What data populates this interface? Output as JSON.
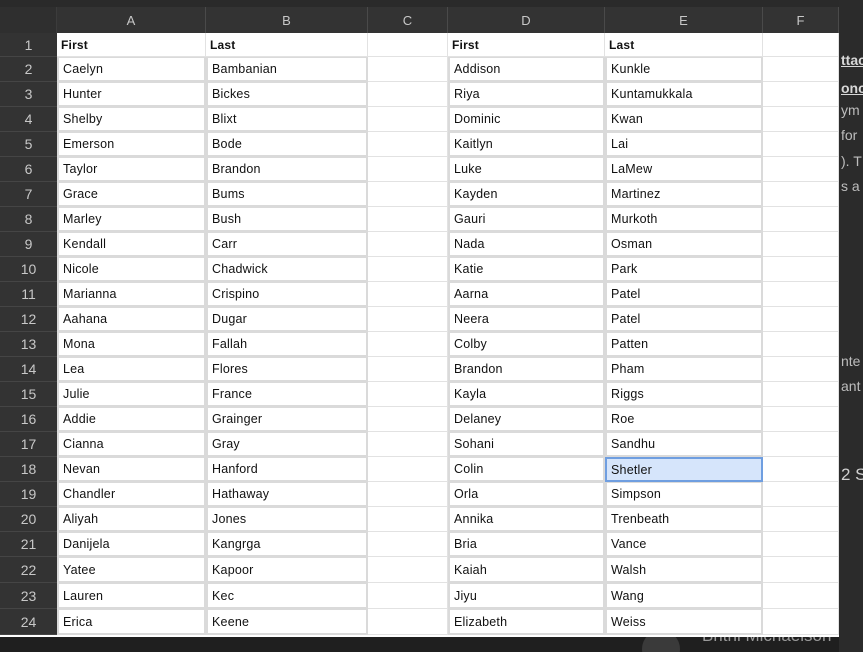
{
  "sheet": {
    "columns": [
      "A",
      "B",
      "C",
      "D",
      "E",
      "F"
    ],
    "rows": [
      "1",
      "2",
      "3",
      "4",
      "5",
      "6",
      "7",
      "8",
      "9",
      "10",
      "11",
      "12",
      "13",
      "14",
      "15",
      "16",
      "17",
      "18",
      "19",
      "20",
      "21",
      "22",
      "23",
      "24"
    ],
    "table_left": {
      "headers": [
        "First",
        "Last"
      ],
      "rows": [
        [
          "Caelyn",
          "Bambanian"
        ],
        [
          "Hunter",
          "Bickes"
        ],
        [
          "Shelby",
          "Blixt"
        ],
        [
          "Emerson",
          "Bode"
        ],
        [
          "Taylor",
          "Brandon"
        ],
        [
          "Grace",
          "Bums"
        ],
        [
          "Marley",
          "Bush"
        ],
        [
          "Kendall",
          "Carr"
        ],
        [
          "Nicole",
          "Chadwick"
        ],
        [
          "Marianna",
          "Crispino"
        ],
        [
          "Aahana",
          "Dugar"
        ],
        [
          "Mona",
          "Fallah"
        ],
        [
          "Lea",
          "Flores"
        ],
        [
          "Julie",
          "France"
        ],
        [
          "Addie",
          "Grainger"
        ],
        [
          "Cianna",
          "Gray"
        ],
        [
          "Nevan",
          "Hanford"
        ],
        [
          "Chandler",
          "Hathaway"
        ],
        [
          "Aliyah",
          "Jones"
        ],
        [
          "Danijela",
          "Kangrga"
        ],
        [
          "Yatee",
          "Kapoor"
        ],
        [
          "Lauren",
          "Kec"
        ],
        [
          "Erica",
          "Keene"
        ]
      ]
    },
    "table_right": {
      "headers": [
        "First",
        "Last"
      ],
      "rows": [
        [
          "Addison",
          "Kunkle"
        ],
        [
          "Riya",
          "Kuntamukkala"
        ],
        [
          "Dominic",
          "Kwan"
        ],
        [
          "Kaitlyn",
          "Lai"
        ],
        [
          "Luke",
          "LaMew"
        ],
        [
          "Kayden",
          "Martinez"
        ],
        [
          "Gauri",
          "Murkoth"
        ],
        [
          "Nada",
          "Osman"
        ],
        [
          "Katie",
          "Park"
        ],
        [
          "Aarna",
          "Patel"
        ],
        [
          "Neera",
          "Patel"
        ],
        [
          "Colby",
          "Patten"
        ],
        [
          "Brandon",
          "Pham"
        ],
        [
          "Kayla",
          "Riggs"
        ],
        [
          "Delaney",
          "Roe"
        ],
        [
          "Sohani",
          "Sandhu"
        ],
        [
          "Colin",
          "Shetler"
        ],
        [
          "Orla",
          "Simpson"
        ],
        [
          "Annika",
          "Trenbeath"
        ],
        [
          "Bria",
          "Vance"
        ],
        [
          "Kaiah",
          "Walsh"
        ],
        [
          "Jiyu",
          "Wang"
        ],
        [
          "Elizabeth",
          "Weiss"
        ]
      ]
    },
    "selected_cell": "E18"
  },
  "background": {
    "right_fragments": [
      "ttac",
      "onc",
      "ym",
      "for",
      "). T",
      "s a",
      "nte",
      "ant",
      "2 S"
    ],
    "bottom_name": "Britni Michaelson"
  }
}
